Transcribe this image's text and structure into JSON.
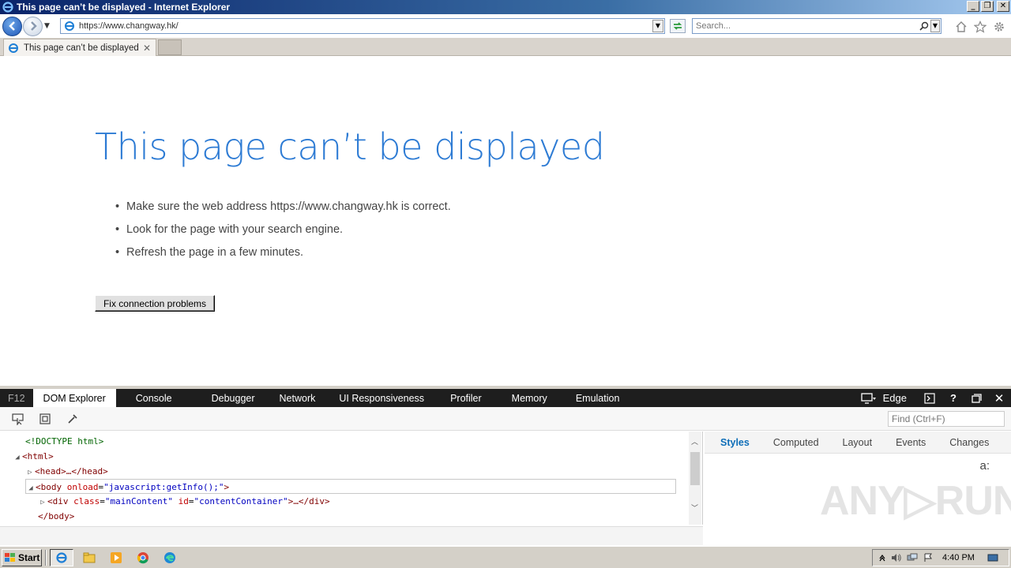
{
  "window": {
    "title": "This page can’t be displayed - Internet Explorer",
    "controls": [
      "minimize",
      "restore",
      "close"
    ]
  },
  "navbar": {
    "url": "https://www.changway.hk/",
    "search_placeholder": "Search..."
  },
  "tabs": [
    {
      "label": "This page can’t be displayed"
    }
  ],
  "page": {
    "title": "This page can’t be displayed",
    "bullets": [
      "Make sure the web address https://www.changway.hk is correct.",
      "Look for the page with your search engine.",
      "Refresh the page in a few minutes."
    ],
    "button_label": "Fix connection problems"
  },
  "devtools": {
    "f12_label": "F12",
    "tabs": [
      "DOM Explorer",
      "Console",
      "Debugger",
      "Network",
      "UI Responsiveness",
      "Profiler",
      "Memory",
      "Emulation"
    ],
    "active_tab": "DOM Explorer",
    "mode_label": "Edge",
    "find_placeholder": "Find (Ctrl+F)",
    "dom_lines": {
      "doctype": "<!DOCTYPE html>",
      "html_open": "<html>",
      "head": "<head>…</head>",
      "body_tag": "body",
      "body_attr": "onload",
      "body_val": "\"javascript:getInfo();\"",
      "div_tag": "div",
      "div_attr1": "class",
      "div_val1": "\"mainContent\"",
      "div_attr2": "id",
      "div_val2": "\"contentContainer\"",
      "div_close": "…</div>",
      "body_close": "</body>"
    },
    "style_tabs": [
      "Styles",
      "Computed",
      "Layout",
      "Events",
      "Changes"
    ],
    "active_style_tab": "Styles",
    "font_size_glyph": "a:",
    "watermark": "ANY▷RUN"
  },
  "taskbar": {
    "start_label": "Start",
    "clock": "4:40 PM"
  }
}
